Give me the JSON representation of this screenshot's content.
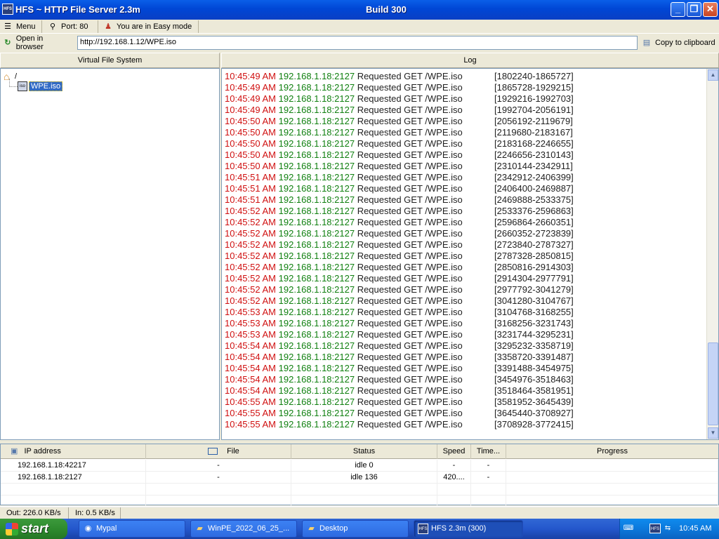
{
  "window": {
    "title": "HFS ~ HTTP File Server 2.3m",
    "build": "Build 300",
    "minimize": "_",
    "maximize": "❐",
    "close": "✕"
  },
  "toolbar": {
    "menu_label": "Menu",
    "port_label": "Port: 80",
    "mode_label": "You are in Easy mode",
    "open_browser_label": "Open in browser",
    "url_value": "http://192.168.1.12/WPE.iso",
    "copy_label": "Copy to clipboard"
  },
  "vfs": {
    "header": "Virtual File System",
    "root": "/",
    "file_icon": "iso",
    "file": "WPE.iso"
  },
  "log": {
    "header": "Log",
    "entries": [
      {
        "time": "10:45:49 AM",
        "ip": "192.168.1.18:2127",
        "msg": "Requested GET /WPE.iso",
        "range": "[1802240-1865727]"
      },
      {
        "time": "10:45:49 AM",
        "ip": "192.168.1.18:2127",
        "msg": "Requested GET /WPE.iso",
        "range": "[1865728-1929215]"
      },
      {
        "time": "10:45:49 AM",
        "ip": "192.168.1.18:2127",
        "msg": "Requested GET /WPE.iso",
        "range": "[1929216-1992703]"
      },
      {
        "time": "10:45:49 AM",
        "ip": "192.168.1.18:2127",
        "msg": "Requested GET /WPE.iso",
        "range": "[1992704-2056191]"
      },
      {
        "time": "10:45:50 AM",
        "ip": "192.168.1.18:2127",
        "msg": "Requested GET /WPE.iso",
        "range": "[2056192-2119679]"
      },
      {
        "time": "10:45:50 AM",
        "ip": "192.168.1.18:2127",
        "msg": "Requested GET /WPE.iso",
        "range": "[2119680-2183167]"
      },
      {
        "time": "10:45:50 AM",
        "ip": "192.168.1.18:2127",
        "msg": "Requested GET /WPE.iso",
        "range": "[2183168-2246655]"
      },
      {
        "time": "10:45:50 AM",
        "ip": "192.168.1.18:2127",
        "msg": "Requested GET /WPE.iso",
        "range": "[2246656-2310143]"
      },
      {
        "time": "10:45:50 AM",
        "ip": "192.168.1.18:2127",
        "msg": "Requested GET /WPE.iso",
        "range": "[2310144-2342911]"
      },
      {
        "time": "10:45:51 AM",
        "ip": "192.168.1.18:2127",
        "msg": "Requested GET /WPE.iso",
        "range": "[2342912-2406399]"
      },
      {
        "time": "10:45:51 AM",
        "ip": "192.168.1.18:2127",
        "msg": "Requested GET /WPE.iso",
        "range": "[2406400-2469887]"
      },
      {
        "time": "10:45:51 AM",
        "ip": "192.168.1.18:2127",
        "msg": "Requested GET /WPE.iso",
        "range": "[2469888-2533375]"
      },
      {
        "time": "10:45:52 AM",
        "ip": "192.168.1.18:2127",
        "msg": "Requested GET /WPE.iso",
        "range": "[2533376-2596863]"
      },
      {
        "time": "10:45:52 AM",
        "ip": "192.168.1.18:2127",
        "msg": "Requested GET /WPE.iso",
        "range": "[2596864-2660351]"
      },
      {
        "time": "10:45:52 AM",
        "ip": "192.168.1.18:2127",
        "msg": "Requested GET /WPE.iso",
        "range": "[2660352-2723839]"
      },
      {
        "time": "10:45:52 AM",
        "ip": "192.168.1.18:2127",
        "msg": "Requested GET /WPE.iso",
        "range": "[2723840-2787327]"
      },
      {
        "time": "10:45:52 AM",
        "ip": "192.168.1.18:2127",
        "msg": "Requested GET /WPE.iso",
        "range": "[2787328-2850815]"
      },
      {
        "time": "10:45:52 AM",
        "ip": "192.168.1.18:2127",
        "msg": "Requested GET /WPE.iso",
        "range": "[2850816-2914303]"
      },
      {
        "time": "10:45:52 AM",
        "ip": "192.168.1.18:2127",
        "msg": "Requested GET /WPE.iso",
        "range": "[2914304-2977791]"
      },
      {
        "time": "10:45:52 AM",
        "ip": "192.168.1.18:2127",
        "msg": "Requested GET /WPE.iso",
        "range": "[2977792-3041279]"
      },
      {
        "time": "10:45:52 AM",
        "ip": "192.168.1.18:2127",
        "msg": "Requested GET /WPE.iso",
        "range": "[3041280-3104767]"
      },
      {
        "time": "10:45:53 AM",
        "ip": "192.168.1.18:2127",
        "msg": "Requested GET /WPE.iso",
        "range": "[3104768-3168255]"
      },
      {
        "time": "10:45:53 AM",
        "ip": "192.168.1.18:2127",
        "msg": "Requested GET /WPE.iso",
        "range": "[3168256-3231743]"
      },
      {
        "time": "10:45:53 AM",
        "ip": "192.168.1.18:2127",
        "msg": "Requested GET /WPE.iso",
        "range": "[3231744-3295231]"
      },
      {
        "time": "10:45:54 AM",
        "ip": "192.168.1.18:2127",
        "msg": "Requested GET /WPE.iso",
        "range": "[3295232-3358719]"
      },
      {
        "time": "10:45:54 AM",
        "ip": "192.168.1.18:2127",
        "msg": "Requested GET /WPE.iso",
        "range": "[3358720-3391487]"
      },
      {
        "time": "10:45:54 AM",
        "ip": "192.168.1.18:2127",
        "msg": "Requested GET /WPE.iso",
        "range": "[3391488-3454975]"
      },
      {
        "time": "10:45:54 AM",
        "ip": "192.168.1.18:2127",
        "msg": "Requested GET /WPE.iso",
        "range": "[3454976-3518463]"
      },
      {
        "time": "10:45:54 AM",
        "ip": "192.168.1.18:2127",
        "msg": "Requested GET /WPE.iso",
        "range": "[3518464-3581951]"
      },
      {
        "time": "10:45:55 AM",
        "ip": "192.168.1.18:2127",
        "msg": "Requested GET /WPE.iso",
        "range": "[3581952-3645439]"
      },
      {
        "time": "10:45:55 AM",
        "ip": "192.168.1.18:2127",
        "msg": "Requested GET /WPE.iso",
        "range": "[3645440-3708927]"
      },
      {
        "time": "10:45:55 AM",
        "ip": "192.168.1.18:2127",
        "msg": "Requested GET /WPE.iso",
        "range": "[3708928-3772415]"
      }
    ]
  },
  "connections": {
    "headers": {
      "ip": "IP address",
      "file": "File",
      "status": "Status",
      "speed": "Speed",
      "time": "Time...",
      "progress": "Progress"
    },
    "rows": [
      {
        "ip": "192.168.1.18:42217",
        "file": "-",
        "status": "idle 0",
        "speed": "-",
        "time": "-",
        "progress": ""
      },
      {
        "ip": "192.168.1.18:2127",
        "file": "-",
        "status": "idle 136",
        "speed": "420....",
        "time": "-",
        "progress": ""
      }
    ]
  },
  "statusbar": {
    "out": "Out: 226.0 KB/s",
    "in": "In: 0.5 KB/s"
  },
  "taskbar": {
    "start": "start",
    "tasks": [
      {
        "label": "Mypal",
        "icon": "browser-icon"
      },
      {
        "label": "WinPE_2022_06_25_...",
        "icon": "folder-icon"
      },
      {
        "label": "Desktop",
        "icon": "folder-icon"
      },
      {
        "label": "HFS 2.3m (300)",
        "icon": "hfs-icon"
      }
    ],
    "clock": "10:45 AM",
    "tray_hfs_label": "HFS"
  }
}
